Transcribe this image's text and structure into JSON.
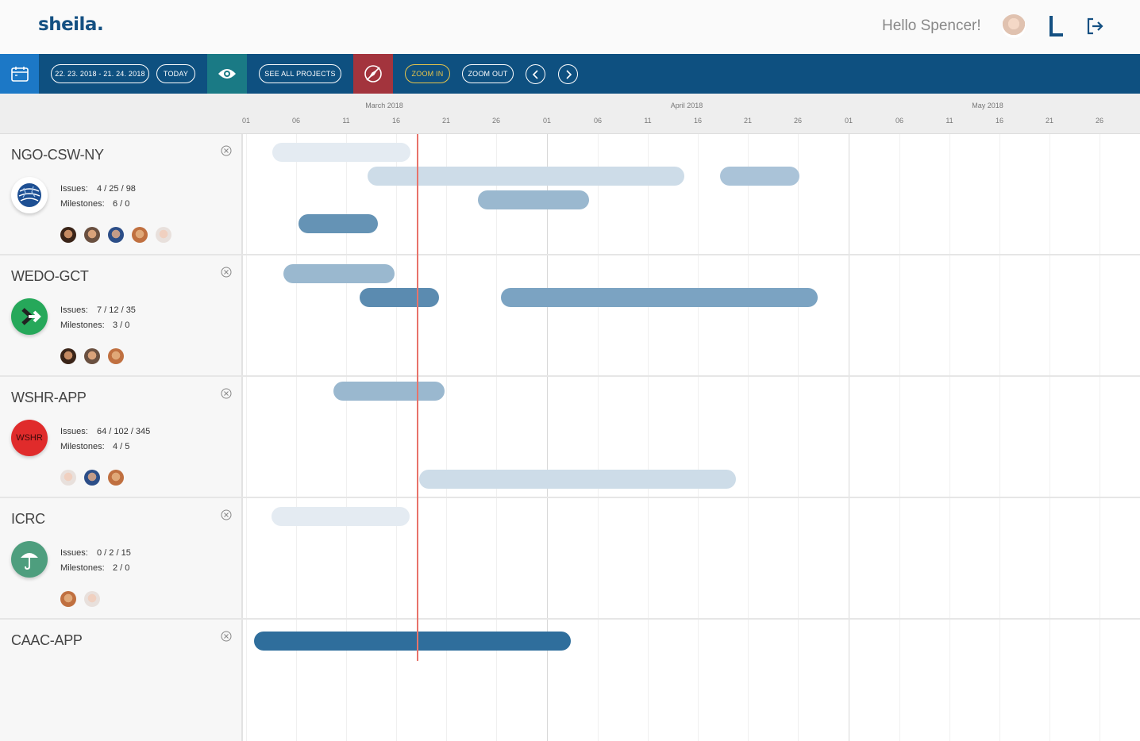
{
  "header": {
    "logo": "sheila.",
    "greeting": "Hello Spencer!"
  },
  "toolbar": {
    "date_range": "22. 23. 2018 - 21. 24. 2018",
    "today": "TODAY",
    "see_all": "SEE ALL PROJECTS",
    "zoom_in": "ZOOM IN",
    "zoom_out": "ZOOM OUT",
    "colors": {
      "bar": "#0e5080",
      "calendar": "#1c78c6",
      "eye": "#1a7a85",
      "compass": "#a3343d",
      "zoom_in": "#e8c54a"
    }
  },
  "timeline": {
    "months": [
      "March 2018",
      "April 2018",
      "May 2018"
    ],
    "days": [
      "01",
      "06",
      "11",
      "16",
      "21",
      "26",
      "01",
      "06",
      "11",
      "16",
      "21",
      "26",
      "01",
      "06",
      "11",
      "16",
      "21",
      "26"
    ]
  },
  "projects": [
    {
      "name": "NGO-CSW-NY",
      "issues_label": "Issues:",
      "issues": "4 / 25 / 98",
      "milestones_label": "Milestones:",
      "milestones": "6 / 0",
      "logo": "globe-logo",
      "avatars": 5
    },
    {
      "name": "WEDO-GCT",
      "issues_label": "Issues:",
      "issues": "7 / 12 / 35",
      "milestones_label": "Milestones:",
      "milestones": "3 / 0",
      "logo": "arrow-logo",
      "avatars": 3
    },
    {
      "name": "WSHR-APP",
      "issues_label": "Issues:",
      "issues": "64 / 102 / 345",
      "milestones_label": "Milestones:",
      "milestones": "4 / 5",
      "logo": "wshr-logo",
      "logo_text": "WSHR",
      "avatars": 3
    },
    {
      "name": "ICRC",
      "issues_label": "Issues:",
      "issues": "0 / 2 / 15",
      "milestones_label": "Milestones:",
      "milestones": "2 / 0",
      "logo": "umbrella-logo",
      "avatars": 2
    },
    {
      "name": "CAAC-APP",
      "logo": "none",
      "avatars": 0
    }
  ]
}
